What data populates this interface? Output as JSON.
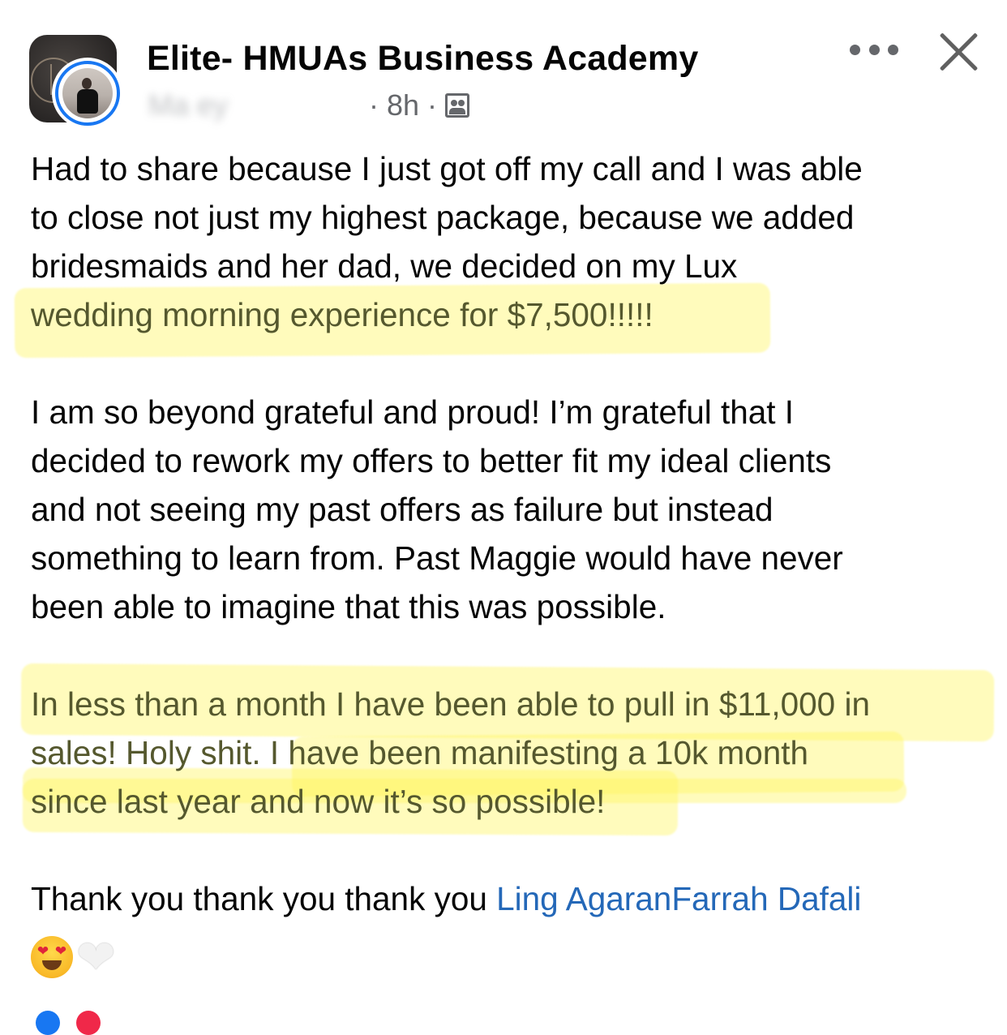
{
  "header": {
    "group_name": "Elite- HMUAs Business Academy",
    "author_name": "Ma               ey",
    "time_ago": "8h",
    "separator": "·",
    "audience_icon": "group-members-icon",
    "more_icon": "more-options-icon",
    "close_icon": "close-icon"
  },
  "post": {
    "paragraph1": [
      "Had to share because I just got off my call and I was able",
      "to close not just my highest package, because we added",
      "bridesmaids and her dad, we decided on my Lux"
    ],
    "paragraph1_highlighted": "wedding morning experience for $7,500!!!!!",
    "paragraph2": [
      "I am so beyond grateful and proud! I’m grateful that I",
      "decided to rework my offers to better fit my ideal clients",
      "and not seeing my past offers as failure but instead",
      "something to learn from. Past Maggie would have never",
      "been able to imagine that this was possible."
    ],
    "paragraph3": [
      "In less than a month I have been able to pull in $11,000 in",
      "sales! Holy shit. I have been manifesting a 10k month",
      "since last year and now it’s so possible!"
    ],
    "thanks_text": "Thank you thank you thank you ",
    "mentions": [
      "Ling Agaran",
      "Farrah Dafali"
    ],
    "emojis": [
      "heart-eyes-emoji",
      "white-heart-emoji"
    ]
  },
  "colors": {
    "highlight": "#fff560",
    "mention": "#2468b8",
    "muted": "#65676b",
    "avatar_ring": "#1877f2"
  }
}
